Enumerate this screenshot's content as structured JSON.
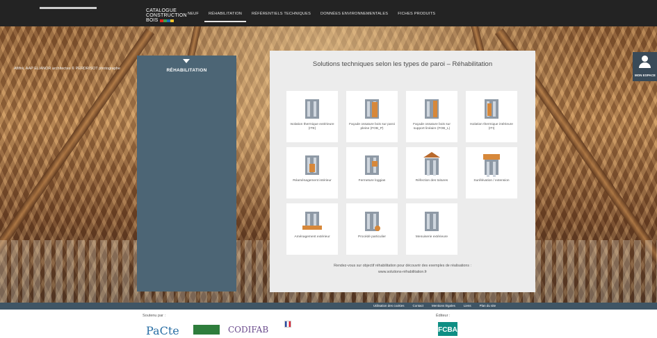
{
  "header": {
    "logo": {
      "line1": "CATALOGUE",
      "line2": "CONSTRUCTION",
      "line3": "BOIS"
    },
    "nav": [
      {
        "label": "NEUF",
        "active": false
      },
      {
        "label": "RÉHABILITATION",
        "active": true
      },
      {
        "label": "RÉFÉRENTIELS TECHNIQUES",
        "active": false
      },
      {
        "label": "DONNÉES ENVIRONNEMENTALES",
        "active": false
      },
      {
        "label": "FICHES PRODUITS",
        "active": false
      }
    ]
  },
  "hero": {
    "credit": "Afilfré, AAP ELIANOR architectes © PERDRISOT photographe"
  },
  "sidebar": {
    "title": "RÉHABILITATION",
    "arrow_icon": "caret-down-icon"
  },
  "main": {
    "heading": "Solutions techniques selon les types de paroi – Réhabilitation",
    "tiles": [
      {
        "label": "Isolation thermique extérieure (ITE)",
        "icon": "wall-panel-icon"
      },
      {
        "label": "Façade ossature bois sur paroi pleine (FOB_P)",
        "icon": "facade-frame-icon"
      },
      {
        "label": "Façade ossature bois sur support linéaire (FOB_L)",
        "icon": "facade-linear-icon"
      },
      {
        "label": "Isolation thermique intérieure (ITI)",
        "icon": "interior-insulation-icon"
      },
      {
        "label": "Réaménagement intérieur",
        "icon": "interior-layout-icon"
      },
      {
        "label": "Fermeture loggias",
        "icon": "loggia-icon"
      },
      {
        "label": "Réfection des toitures",
        "icon": "roof-icon"
      },
      {
        "label": "Surélévation / extension",
        "icon": "extension-icon"
      },
      {
        "label": "Aménagement extérieur",
        "icon": "exterior-deck-icon"
      },
      {
        "label": "Procédé particulier",
        "icon": "special-process-icon"
      },
      {
        "label": "Menuiserie extérieure",
        "icon": "window-joinery-icon"
      }
    ],
    "footer_line1": "Rendez-vous sur objectif réhabilitation pour découvrir des exemples de réalisations :",
    "footer_line2": "www.solutions-réhabilitation.fr"
  },
  "profile": {
    "label": "MON ESPACE",
    "icon": "user-icon"
  },
  "footbar": {
    "links": [
      "Utilisation des cookies",
      "Contact",
      "Mentions légales",
      "Liens",
      "Plan du site"
    ]
  },
  "bottom": {
    "supported_by": "Soutenu par :",
    "editor": "Éditeur :",
    "partners": [
      "PaCte",
      "CODIFAB"
    ],
    "editor_logo": "FCBA"
  },
  "colors": {
    "topbar": "#232323",
    "panel": "#4c6575",
    "card": "#ececec",
    "accent": "#d7883a"
  }
}
